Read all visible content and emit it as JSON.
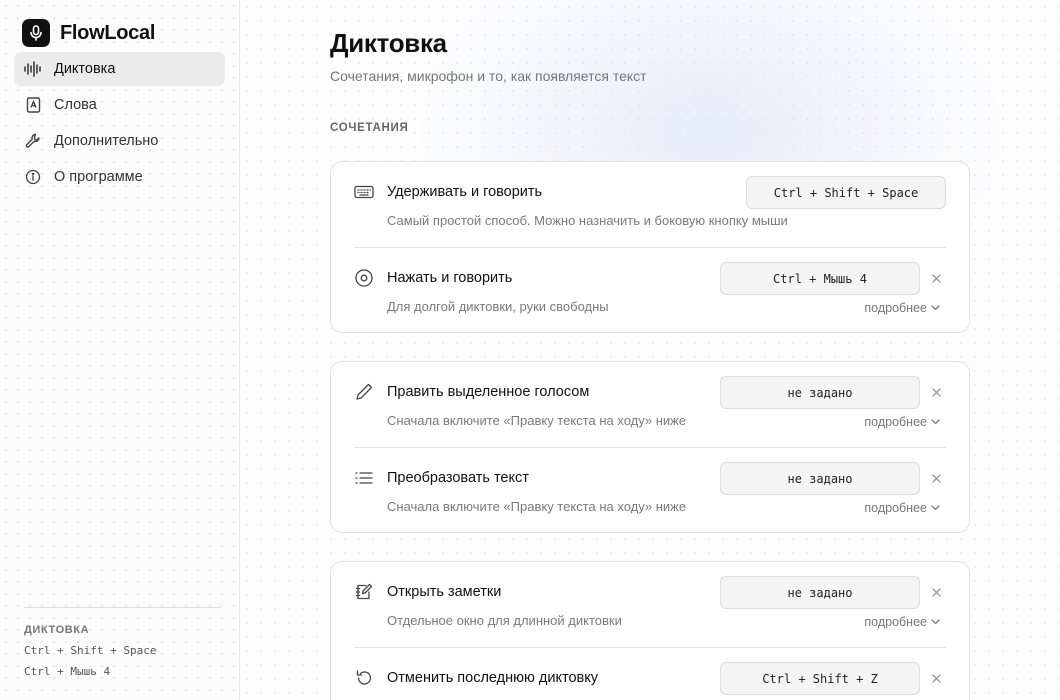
{
  "app": {
    "name": "FlowLocal"
  },
  "sidebar": {
    "items": [
      {
        "label": "Диктовка",
        "icon": "waveform-icon",
        "active": true
      },
      {
        "label": "Слова",
        "icon": "dictionary-icon",
        "active": false
      },
      {
        "label": "Дополнительно",
        "icon": "wrench-icon",
        "active": false
      },
      {
        "label": "О программе",
        "icon": "info-icon",
        "active": false
      }
    ],
    "footer": {
      "title": "ДИКТОВКА",
      "shortcuts": [
        "Ctrl + Shift + Space",
        "Ctrl + Мышь 4"
      ]
    }
  },
  "main": {
    "title": "Диктовка",
    "subtitle": "Сочетания, микрофон и то, как появляется текст",
    "section_title": "СОЧЕТАНИЯ",
    "more_label": "подробнее",
    "cards": [
      {
        "rows": [
          {
            "icon": "keyboard-icon",
            "title": "Удерживать и говорить",
            "desc": "Самый простой способ. Можно назначить и боковую кнопку мыши",
            "shortcut": "Ctrl + Shift + Space"
          },
          {
            "icon": "record-icon",
            "title": "Нажать и говорить",
            "desc": "Для долгой диктовки, руки свободны",
            "shortcut": "Ctrl + Мышь 4"
          }
        ]
      },
      {
        "rows": [
          {
            "icon": "pencil-icon",
            "title": "Править выделенное голосом",
            "desc": "Сначала включите «Правку текста на ходу» ниже",
            "shortcut": "не задано"
          },
          {
            "icon": "list-icon",
            "title": "Преобразовать текст",
            "desc": "Сначала включите «Правку текста на ходу» ниже",
            "shortcut": "не задано"
          }
        ]
      },
      {
        "rows": [
          {
            "icon": "notes-icon",
            "title": "Открыть заметки",
            "desc": "Отдельное окно для длинной диктовки",
            "shortcut": "не задано"
          },
          {
            "icon": "undo-icon",
            "title": "Отменить последнюю диктовку",
            "desc": "",
            "shortcut": "Ctrl + Shift + Z"
          }
        ]
      }
    ]
  }
}
